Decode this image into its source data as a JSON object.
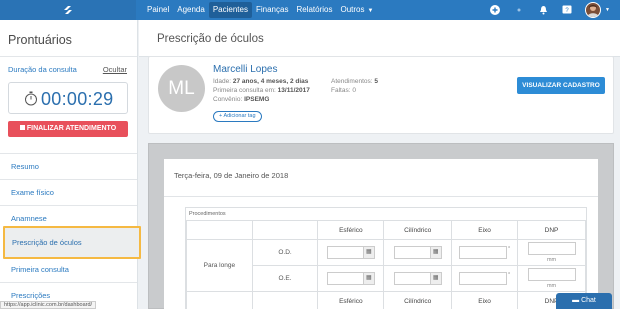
{
  "topbar": {
    "nav": [
      "Painel",
      "Agenda",
      "Pacientes",
      "Finanças",
      "Relatórios",
      "Outros"
    ],
    "active": "Pacientes"
  },
  "sidebar": {
    "title": "Prontuários",
    "duration_label": "Duração da consulta",
    "hide_label": "Ocultar",
    "timer": "00:00:29",
    "finish_label": "FINALIZAR ATENDIMENTO",
    "items": [
      "Resumo",
      "Exame físico",
      "Anamnese",
      "Prescrição de óculos",
      "Primeira consulta",
      "Prescrições"
    ]
  },
  "status_url": "https://app.iclinic.com.br/dashboard/",
  "main": {
    "title": "Prescrição de óculos",
    "patient": {
      "initials": "ML",
      "name": "Marcelli Lopes",
      "age_label": "Idade:",
      "age": "27 anos, 4 meses, 2 dias",
      "first_visit_label": "Primeira consulta em:",
      "first_visit": "13/11/2017",
      "insurance_label": "Convênio:",
      "insurance": "IPSEMG",
      "appointments_label": "Atendimentos:",
      "appointments": "5",
      "absences_label": "Faltas:",
      "absences": "0",
      "add_tag": "Adicionar tag",
      "view_button": "VISUALIZAR CADASTRO"
    },
    "prescription": {
      "date": "Terça-feira, 09 de Janeiro de 2018",
      "section": "Procedimentos",
      "columns": [
        "Esférico",
        "Cilíndrico",
        "Eixo",
        "DNP"
      ],
      "row_group": "Para longe",
      "eyes": [
        "O.D.",
        "O.E."
      ],
      "unit": "mm",
      "degree": "°"
    }
  },
  "chat_label": "Chat",
  "colors": {
    "primary": "#2b7ac0",
    "danger": "#e8505b",
    "highlight": "#f5b942"
  }
}
